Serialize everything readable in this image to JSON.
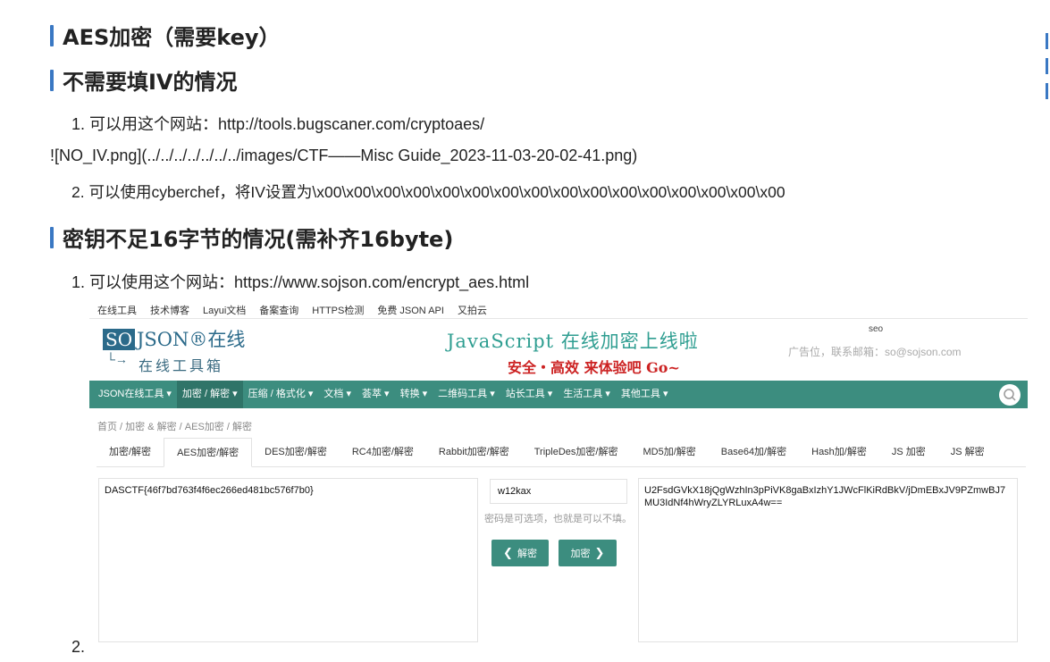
{
  "headings": {
    "h1": "AES加密（需要key）",
    "h2": "不需要填IV的情况",
    "h3": "密钥不足16字节的情况(需补齐16byte)"
  },
  "lines": {
    "l1": "1. 可以用这个网站：http://tools.bugscaner.com/cryptoaes/",
    "l2": "![NO_IV.png](../../../../../../../images/CTF——Misc Guide_2023-11-03-20-02-41.png)",
    "l3": "2. 可以使用cyberchef，将IV设置为\\x00\\x00\\x00\\x00\\x00\\x00\\x00\\x00\\x00\\x00\\x00\\x00\\x00\\x00\\x00\\x00",
    "l4": "1. 可以使用这个网站：https://www.sojson.com/encrypt_aes.html",
    "l5": "2."
  },
  "site": {
    "topnav": [
      "在线工具",
      "技术博客",
      "Layui文档",
      "备案查询",
      "HTTPS检测",
      "免费 JSON API",
      "又拍云"
    ],
    "logo_so": "SO",
    "logo_json": "JSON®在线",
    "logo_sub": "在线工具箱",
    "banner_line1": "JavaScript 在线加密上线啦",
    "banner_line2": "安全・高效 来体验吧 Go~",
    "seo": "seo",
    "ad": "广告位，联系邮箱：so@sojson.com",
    "menu": [
      "JSON在线工具 ▾",
      "加密 / 解密 ▾",
      "压缩 / 格式化 ▾",
      "文档 ▾",
      "荟萃 ▾",
      "转换 ▾",
      "二维码工具 ▾",
      "站长工具 ▾",
      "生活工具 ▾",
      "其他工具 ▾"
    ],
    "breadcrumb": "首页  /  加密 & 解密  /  AES加密 / 解密",
    "tabs": [
      "加密/解密",
      "AES加密/解密",
      "DES加密/解密",
      "RC4加密/解密",
      "Rabbit加密/解密",
      "TripleDes加密/解密",
      "MD5加/解密",
      "Base64加/解密",
      "Hash加/解密",
      "JS 加密",
      "JS 解密"
    ],
    "plaintext": "DASCTF{46f7bd763f4f6ec266ed481bc576f7b0}",
    "key": "w12kax",
    "key_hint": "密码是可选项，也就是可以不填。",
    "decrypt_btn": "解密",
    "encrypt_btn": "加密",
    "ciphertext": "U2FsdGVkX18jQgWzhIn3pPiVK8gaBxIzhY1JWcFlKiRdBkV/jDmEBxJV9PZmwBJ7MU3IdNf4hWryZLYRLuxA4w=="
  },
  "colors": {
    "accent_bar": "#3a78c3",
    "menu_green": "#3c8d7f"
  }
}
